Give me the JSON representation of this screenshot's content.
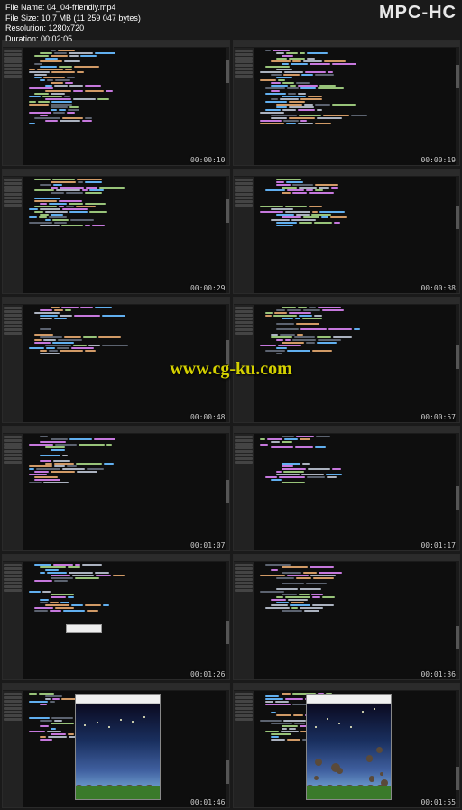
{
  "header": {
    "player_name": "MPC-HC",
    "file_name_label": "File Name:",
    "file_name": "04_04-friendly.mp4",
    "file_size_label": "File Size:",
    "file_size": "10,7 MB (11 259 047 bytes)",
    "resolution_label": "Resolution:",
    "resolution": "1280x720",
    "duration_label": "Duration:",
    "duration": "00:02:05"
  },
  "watermark": "www.cg-ku.com",
  "thumbnails": [
    {
      "timestamp": "00:00:10",
      "variant": "code-dense"
    },
    {
      "timestamp": "00:00:19",
      "variant": "code-dense"
    },
    {
      "timestamp": "00:00:29",
      "variant": "code-sparse"
    },
    {
      "timestamp": "00:00:38",
      "variant": "code-sparse"
    },
    {
      "timestamp": "00:00:48",
      "variant": "code-sparse"
    },
    {
      "timestamp": "00:00:57",
      "variant": "code-sparse"
    },
    {
      "timestamp": "00:01:07",
      "variant": "code-sparse"
    },
    {
      "timestamp": "00:01:17",
      "variant": "code-sparse"
    },
    {
      "timestamp": "00:01:26",
      "variant": "code-autocomplete"
    },
    {
      "timestamp": "00:01:36",
      "variant": "code-sparse"
    },
    {
      "timestamp": "00:01:46",
      "variant": "game-empty"
    },
    {
      "timestamp": "00:01:55",
      "variant": "game-rocks"
    }
  ]
}
